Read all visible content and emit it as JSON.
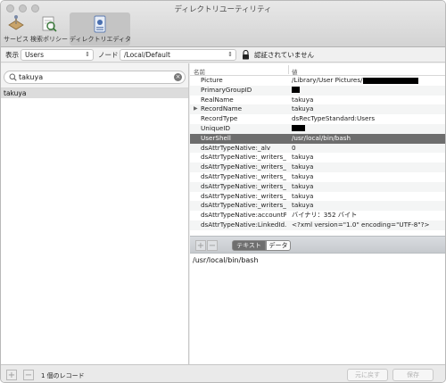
{
  "window": {
    "title": "ディレクトリユーティリティ"
  },
  "toolbar": {
    "items": [
      {
        "label": "サービス"
      },
      {
        "label": "検索ポリシー"
      },
      {
        "label": "ディレクトリエディタ",
        "active": true
      }
    ]
  },
  "nodebar": {
    "view_label": "表示",
    "view_value": "Users",
    "node_label": "ノード",
    "node_value": "/Local/Default",
    "auth_status": "認証されていません"
  },
  "search": {
    "value": "takuya",
    "placeholder": ""
  },
  "records": [
    "takuya"
  ],
  "table": {
    "col_name": "名前",
    "col_value": "値",
    "rows": [
      {
        "name": "Picture",
        "value": "/Library/User Pictures/",
        "redacted": true
      },
      {
        "name": "PrimaryGroupID",
        "value": "",
        "redacted": true
      },
      {
        "name": "RealName",
        "value": "takuya"
      },
      {
        "name": "RecordName",
        "value": "takuya",
        "expandable": true
      },
      {
        "name": "RecordType",
        "value": "dsRecTypeStandard:Users"
      },
      {
        "name": "UniqueID",
        "value": "",
        "redacted": true
      },
      {
        "name": "UserShell",
        "value": "/usr/local/bin/bash",
        "selected": true
      },
      {
        "name": "dsAttrTypeNative:_alv",
        "value": "0"
      },
      {
        "name": "dsAttrTypeNative:_writers_...",
        "value": "takuya"
      },
      {
        "name": "dsAttrTypeNative:_writers_j...",
        "value": "takuya"
      },
      {
        "name": "dsAttrTypeNative:_writers_...",
        "value": "takuya"
      },
      {
        "name": "dsAttrTypeNative:_writers_...",
        "value": "takuya"
      },
      {
        "name": "dsAttrTypeNative:_writers_r...",
        "value": "takuya"
      },
      {
        "name": "dsAttrTypeNative:_writers_...",
        "value": "takuya"
      },
      {
        "name": "dsAttrTypeNative:accountP...",
        "value": "バイナリ：352 バイト"
      },
      {
        "name": "dsAttrTypeNative:LinkedId...",
        "value": "<?xml version=\"1.0\" encoding=\"UTF-8\"?>"
      }
    ]
  },
  "editor": {
    "tab_text": "テキスト",
    "tab_data": "データ",
    "content": "/usr/local/bin/bash"
  },
  "bottom": {
    "record_count": "1 個のレコード",
    "revert_label": "元に戻す",
    "save_label": "保存"
  }
}
